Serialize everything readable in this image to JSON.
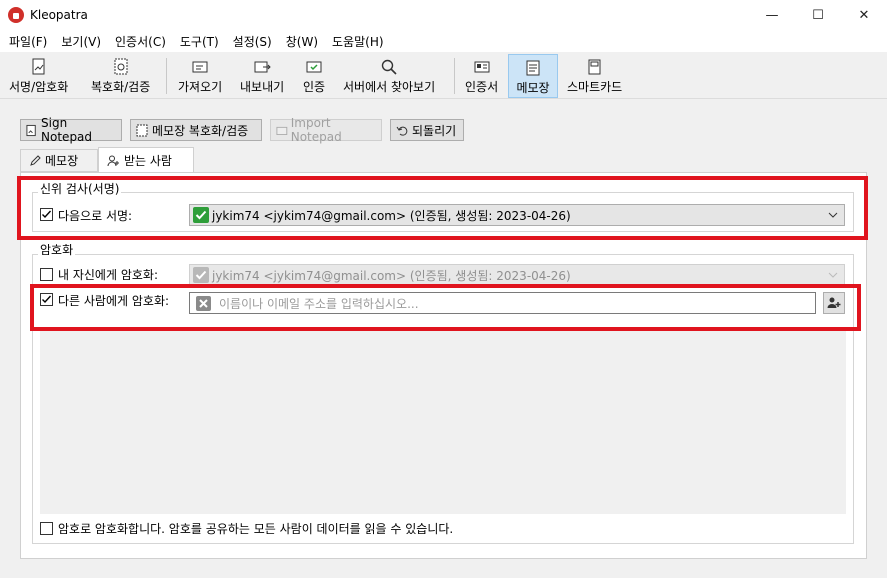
{
  "window": {
    "title": "Kleopatra",
    "controls": {
      "minimize": "—",
      "maximize": "☐",
      "close": "✕"
    }
  },
  "menu": [
    "파일(F)",
    "보기(V)",
    "인증서(C)",
    "도구(T)",
    "설정(S)",
    "창(W)",
    "도움말(H)"
  ],
  "toolbar": {
    "sign_encrypt": "서명/암호화",
    "decrypt_verify": "복호화/검증",
    "import": "가져오기",
    "export": "내보내기",
    "certify": "인증",
    "lookup_server": "서버에서 찾아보기",
    "certificates": "인증서",
    "notepad": "메모장",
    "smartcard": "스마트카드"
  },
  "actions": {
    "sign_notepad": "Sign Notepad",
    "decrypt_verify_notepad": "메모장 복호화/검증",
    "import_notepad": "Import Notepad",
    "revert": "되돌리기"
  },
  "tabs": {
    "notepad": "메모장",
    "recipients": "받는 사람"
  },
  "identity_group": {
    "title": "신위 검사(서명)",
    "sign_as_label": "다음으로 서명:",
    "sign_as_value": "jykim74 <jykim74@gmail.com> (인증됨, 생성됨: 2023-04-26)"
  },
  "encryption_group": {
    "title": "암호화",
    "encrypt_self_label": "내 자신에게 암호화:",
    "encrypt_self_value": "jykim74 <jykim74@gmail.com> (인증됨, 생성됨: 2023-04-26)",
    "encrypt_others_label": "다른 사람에게 암호화:",
    "recipient_placeholder": "이름이나 이메일 주소를 입력하십시오..."
  },
  "password_option": "암호로 암호화합니다. 암호를 공유하는 모든 사람이 데이터를 읽을 수 있습니다.",
  "colors": {
    "highlight_red": "#e0141e",
    "cert_ok_green": "#2e9e3a",
    "active_tool": "#cce4f7"
  }
}
